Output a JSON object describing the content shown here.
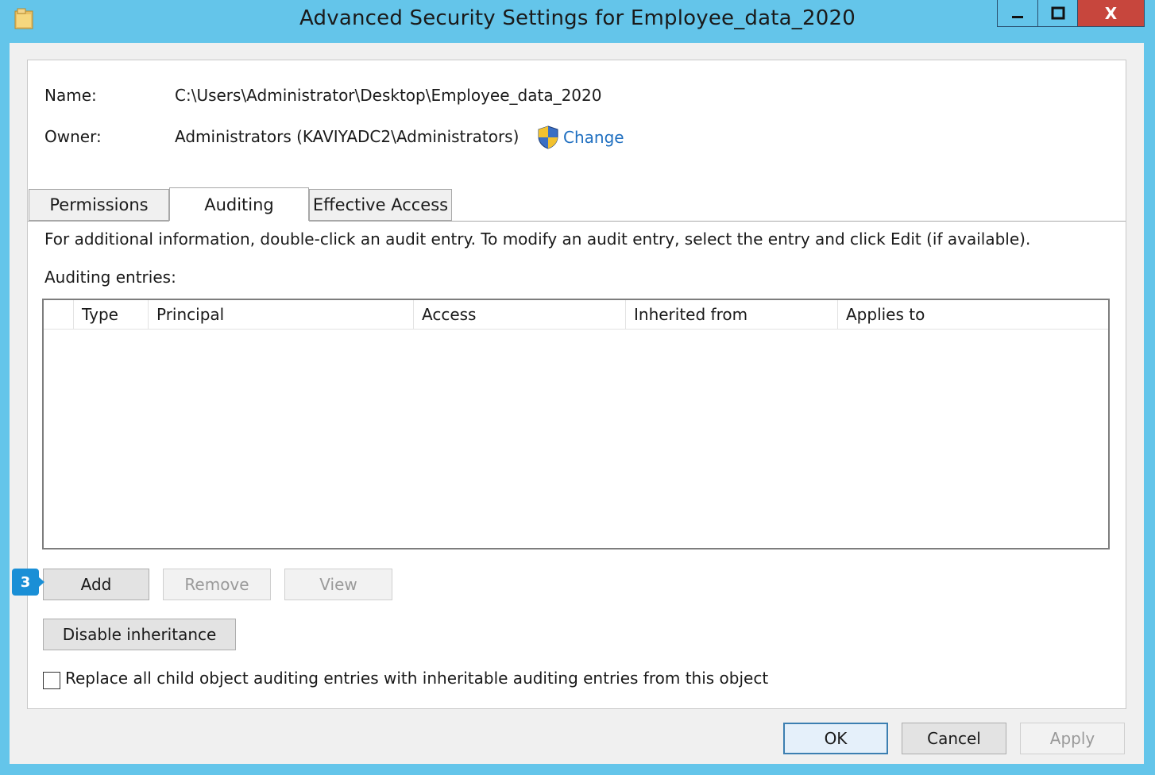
{
  "window": {
    "title": "Advanced Security Settings for Employee_data_2020",
    "minimize_glyph": "—",
    "maximize_glyph": "□",
    "close_glyph": "X"
  },
  "info": {
    "name_label": "Name:",
    "name_value": "C:\\Users\\Administrator\\Desktop\\Employee_data_2020",
    "owner_label": "Owner:",
    "owner_value": "Administrators (KAVIYADC2\\Administrators)",
    "change_link": "Change"
  },
  "tabs": [
    {
      "label": "Permissions",
      "active": false
    },
    {
      "label": "Auditing",
      "active": true
    },
    {
      "label": "Effective Access",
      "active": false
    }
  ],
  "auditing": {
    "instructions": "For additional information, double-click an audit entry. To modify an audit entry, select the entry and click Edit (if available).",
    "entries_label": "Auditing entries:",
    "columns": [
      "Type",
      "Principal",
      "Access",
      "Inherited from",
      "Applies to"
    ],
    "rows": []
  },
  "buttons": {
    "add": "Add",
    "remove": "Remove",
    "view": "View",
    "disable_inheritance": "Disable inheritance",
    "ok": "OK",
    "cancel": "Cancel",
    "apply": "Apply"
  },
  "checkbox": {
    "label": "Replace all child object auditing entries with inheritable auditing entries from this object",
    "checked": false
  },
  "annotation": {
    "step_number": "3"
  },
  "icons": {
    "folder": "folder-icon",
    "uac_shield": "uac-shield-icon"
  },
  "colors": {
    "titlebar": "#64c5ea",
    "close_button": "#c7463d",
    "link": "#1f6fc0",
    "badge": "#1a8fd6"
  }
}
